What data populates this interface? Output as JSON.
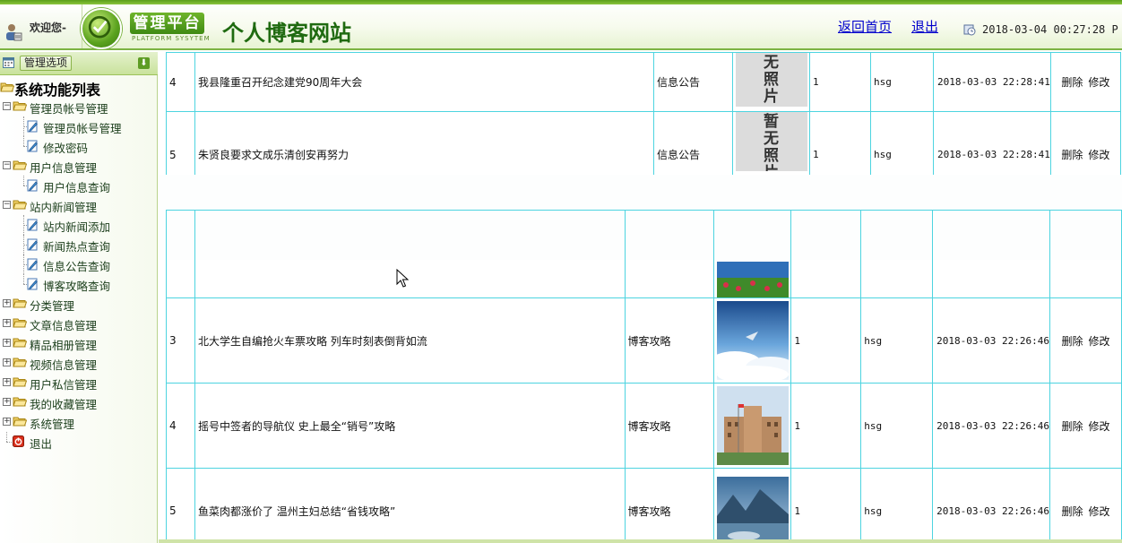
{
  "header": {
    "welcome": "欢迎您-",
    "logo_badge": "管理平台",
    "logo_sub": "PLATFORM SYSYTEM",
    "site_title": "个人博客网站",
    "home_link": "返回首页",
    "logout_link": "退出",
    "datetime": "2018-03-04 00:27:28 P"
  },
  "sidebar": {
    "header_label": "管理选项",
    "root_label": "系统功能列表",
    "groups": [
      {
        "label": "管理员帐号管理",
        "expanded": true,
        "items": [
          "管理员帐号管理",
          "修改密码"
        ]
      },
      {
        "label": "用户信息管理",
        "expanded": true,
        "items": [
          "用户信息查询"
        ]
      },
      {
        "label": "站内新闻管理",
        "expanded": true,
        "items": [
          "站内新闻添加",
          "新闻热点查询",
          "信息公告查询",
          "博客攻略查询"
        ]
      },
      {
        "label": "分类管理",
        "expanded": false,
        "items": []
      },
      {
        "label": "文章信息管理",
        "expanded": false,
        "items": []
      },
      {
        "label": "精品相册管理",
        "expanded": false,
        "items": []
      },
      {
        "label": "视频信息管理",
        "expanded": false,
        "items": []
      },
      {
        "label": "用户私信管理",
        "expanded": false,
        "items": []
      },
      {
        "label": "我的收藏管理",
        "expanded": false,
        "items": []
      },
      {
        "label": "系统管理",
        "expanded": false,
        "items": []
      }
    ],
    "logout_label": "退出"
  },
  "table_top": {
    "rows": [
      {
        "id": "4",
        "title": "我县隆重召开纪念建党90周年大会",
        "category": "信息公告",
        "photo_text": "无照片",
        "count": "1",
        "author": "hsg",
        "time": "2018-03-03 22:28:41",
        "delete": "删除",
        "edit": "修改"
      },
      {
        "id": "5",
        "title": "朱贤良要求文成乐清创安再努力",
        "category": "信息公告",
        "photo_text": "暂无照片",
        "count": "1",
        "author": "hsg",
        "time": "2018-03-03 22:28:41",
        "delete": "删除",
        "edit": "修改"
      }
    ]
  },
  "table_bottom": {
    "rows": [
      {
        "id": "3",
        "title": "北大学生自编抢火车票攻略 列车时刻表倒背如流",
        "category": "博客攻略",
        "photo": "sky-clouds",
        "count": "1",
        "author": "hsg",
        "time": "2018-03-03 22:26:46",
        "delete": "删除",
        "edit": "修改"
      },
      {
        "id": "4",
        "title": "摇号中签者的导航仪 史上最全“销号”攻略",
        "category": "博客攻略",
        "photo": "building",
        "count": "1",
        "author": "hsg",
        "time": "2018-03-03 22:26:46",
        "delete": "删除",
        "edit": "修改"
      },
      {
        "id": "5",
        "title": "鱼菜肉都涨价了 温州主妇总结“省钱攻略”",
        "category": "博客攻略",
        "photo": "mountain-lake",
        "count": "1",
        "author": "hsg",
        "time": "2018-03-03 22:26:46",
        "delete": "删除",
        "edit": "修改"
      }
    ]
  }
}
